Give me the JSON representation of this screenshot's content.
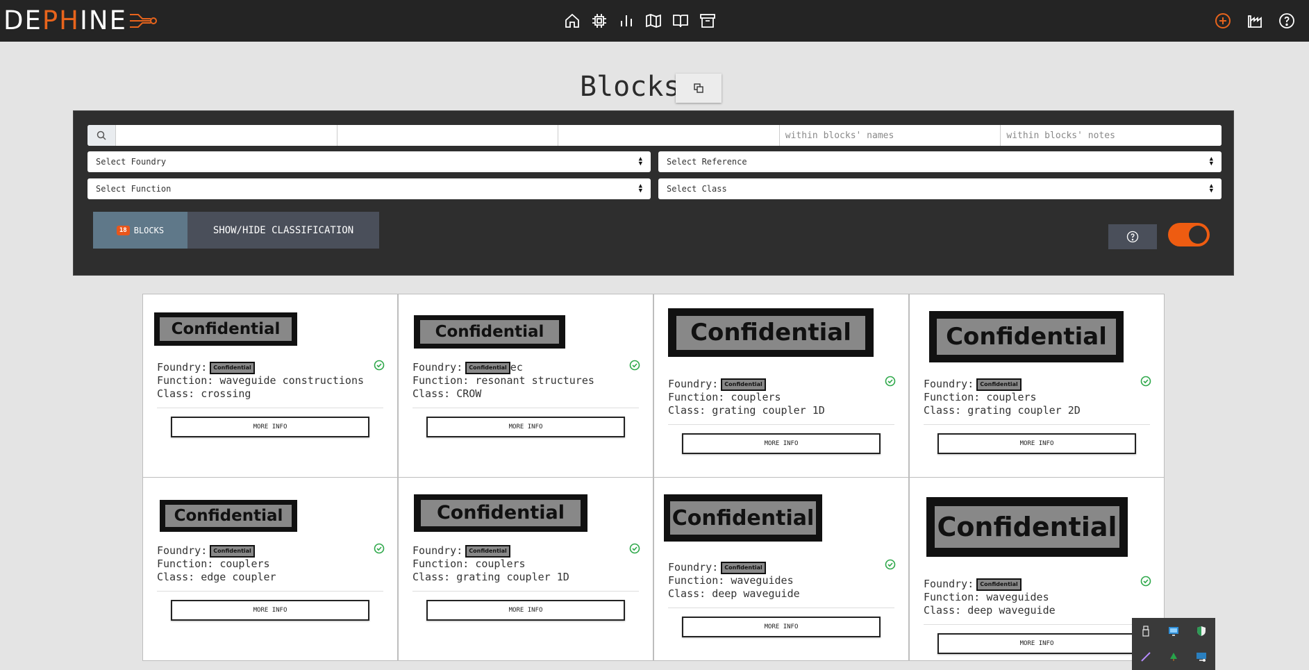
{
  "app": {
    "logo_parts": [
      "DE",
      "PH",
      "INE"
    ],
    "accent": "#e8641c"
  },
  "nav": {
    "center_icons": [
      "home-icon",
      "chip-icon",
      "bar-chart-icon",
      "map-icon",
      "book-icon",
      "archive-icon"
    ],
    "right_icons": [
      "add-circle-icon",
      "factory-icon",
      "help-icon"
    ]
  },
  "page": {
    "title": "Blocks"
  },
  "filters": {
    "search_fields": [
      {
        "placeholder": ""
      },
      {
        "placeholder": ""
      },
      {
        "placeholder": ""
      },
      {
        "placeholder": "within blocks' names"
      },
      {
        "placeholder": "within blocks' notes"
      }
    ],
    "foundry": "Select Foundry",
    "reference": "Select Reference",
    "function": "Select Function",
    "class": "Select Class",
    "blocks_count": "18",
    "blocks_label": "BLOCKS",
    "classification_label": "SHOW/HIDE CLASSIFICATION",
    "toggle_on": true
  },
  "labels": {
    "foundry": "Foundry:",
    "function": "Function:",
    "class": "Class:",
    "more_info": "MORE INFO",
    "redacted": "Confidential"
  },
  "cards": [
    {
      "function": "waveguide constructions",
      "class": "crossing",
      "foundry_suffix": ""
    },
    {
      "function": "resonant structures",
      "class": "CROW",
      "foundry_suffix": "ec"
    },
    {
      "function": "couplers",
      "class": "grating coupler 1D",
      "foundry_suffix": ""
    },
    {
      "function": "couplers",
      "class": "grating coupler 2D",
      "foundry_suffix": ""
    },
    {
      "function": "couplers",
      "class": "edge coupler",
      "foundry_suffix": ""
    },
    {
      "function": "couplers",
      "class": "grating coupler 1D",
      "foundry_suffix": ""
    },
    {
      "function": "waveguides",
      "class": "deep waveguide",
      "foundry_suffix": ""
    },
    {
      "function": "waveguides",
      "class": "deep waveguide",
      "foundry_suffix": ""
    }
  ],
  "tray": {
    "icons": [
      "usb-icon",
      "monitor-icon",
      "shield-icon",
      "pen-icon",
      "tree-icon",
      "display-icon"
    ]
  }
}
